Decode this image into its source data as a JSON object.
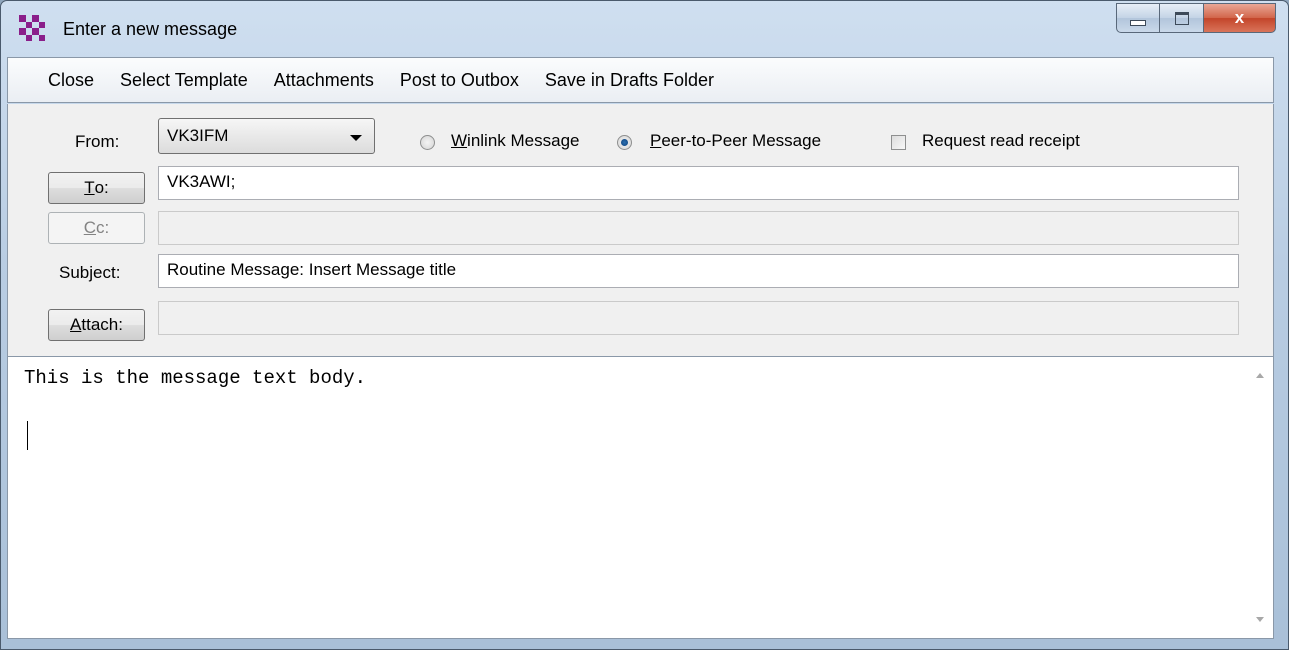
{
  "window": {
    "title": "Enter a new message",
    "close_glyph": "x",
    "icon": "winlink-checker-icon"
  },
  "menu": [
    "Close",
    "Select Template",
    "Attachments",
    "Post to Outbox",
    "Save in Drafts Folder"
  ],
  "form": {
    "from_label": "From:",
    "from_value": "VK3IFM",
    "winlink_radio_label": "Winlink Message",
    "p2p_radio_label": "Peer-to-Peer Message",
    "selected_mode": "Peer-to-Peer Message",
    "read_receipt_label": "Request read receipt",
    "read_receipt_checked": false,
    "to_button": "To:",
    "to_value": "VK3AWI;",
    "cc_button": "Cc:",
    "cc_value": "",
    "subject_label": "Subject:",
    "subject_value": "Routine Message: Insert Message title",
    "attach_button": "Attach:",
    "attach_value": ""
  },
  "body": {
    "text": "This is the message text body."
  },
  "colors": {
    "app_icon": "#8a1e8a",
    "close_button": "#c3452a",
    "radio_selected": "#0c3f7a"
  }
}
